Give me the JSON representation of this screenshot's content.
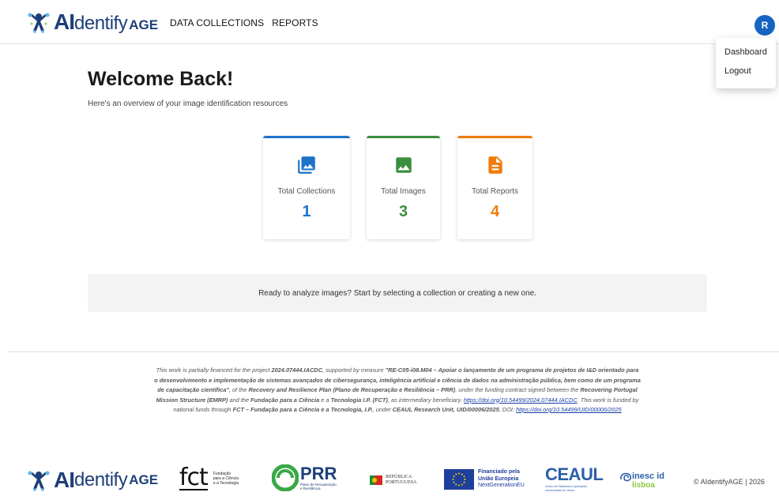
{
  "header": {
    "logo": {
      "ai": "AI",
      "dentify": "dentify",
      "age": "AGE"
    },
    "nav": [
      "DATA COLLECTIONS",
      "REPORTS"
    ],
    "avatar_initial": "R"
  },
  "user_menu": {
    "items": [
      "Dashboard",
      "Logout"
    ]
  },
  "main": {
    "title": "Welcome Back!",
    "subtitle": "Here's an overview of your image identification resources",
    "stats": [
      {
        "label": "Total Collections",
        "value": "1",
        "icon": "collections-icon",
        "color": "#1e73c9"
      },
      {
        "label": "Total Images",
        "value": "3",
        "icon": "image-icon",
        "color": "#3a8f3e"
      },
      {
        "label": "Total Reports",
        "value": "4",
        "icon": "report-icon",
        "color": "#f07c0c"
      }
    ],
    "banner": "Ready to analyze images? Start by selecting a collection or creating a new one."
  },
  "footer": {
    "funding": {
      "p1": "This work is partially financed for the project ",
      "project": "2024.07444.IACDC",
      "p2": ", supported by measure ",
      "measure": "\"RE-C05-i08.M04 – Apoiar o lançamento de um programa de projetos de I&D orientado para o desenvolvimento e implementação de sistemas avançados de cibersegurança, inteligência artificial e ciência de dados na administração pública, bem como de um programa de capacitação científica\"",
      "p3": ", of the ",
      "prr": "Recovery and Resilience Plan (Plano de Recuperação e Resiliência – PRR)",
      "p4": ", under the funding contract signed between the ",
      "emrp": "Recovering Portugal Mission Structure (EMRP)",
      "p5": " and the ",
      "fct": "Fundação para a Ciência",
      "p6": " e a ",
      "fct2": "Tecnologia I.P. (FCT)",
      "p7": ", as intermediary beneficiary. ",
      "doi1": "https://doi.org/10.54499/2024.07444.IACDC",
      "p8": ". This work is funded by national funds through ",
      "fct3": "FCT – Fundação para a Ciência e a Tecnologia, I.P.",
      "p9": ", under ",
      "ceaul": "CEAUL Research Unit, UID/00006/2025",
      "p10": ", DOI: ",
      "doi2": "https://doi.org/10.54499/UID/00006/2025"
    },
    "logos": {
      "fct_big": "fct",
      "fct_small": [
        "Fundação",
        "para a Ciência",
        "e a Tecnologia"
      ],
      "prr_big": "PRR",
      "prr_small": [
        "Plano de Recuperação",
        "e Resiliência"
      ],
      "republica": [
        "REPÚBLICA",
        "PORTUGUESA"
      ],
      "eu": [
        "Financiado pela",
        "União Europeia",
        "NextGenerationEU"
      ],
      "ceaul": "CEAUL",
      "ceaul_small": [
        "Centro de Estatística e Aplicações",
        "Universidade de Lisboa"
      ],
      "inesc": "inesc id",
      "lisboa": "lisboa"
    },
    "copyright": "© AIdentifyAGE | 2026"
  }
}
